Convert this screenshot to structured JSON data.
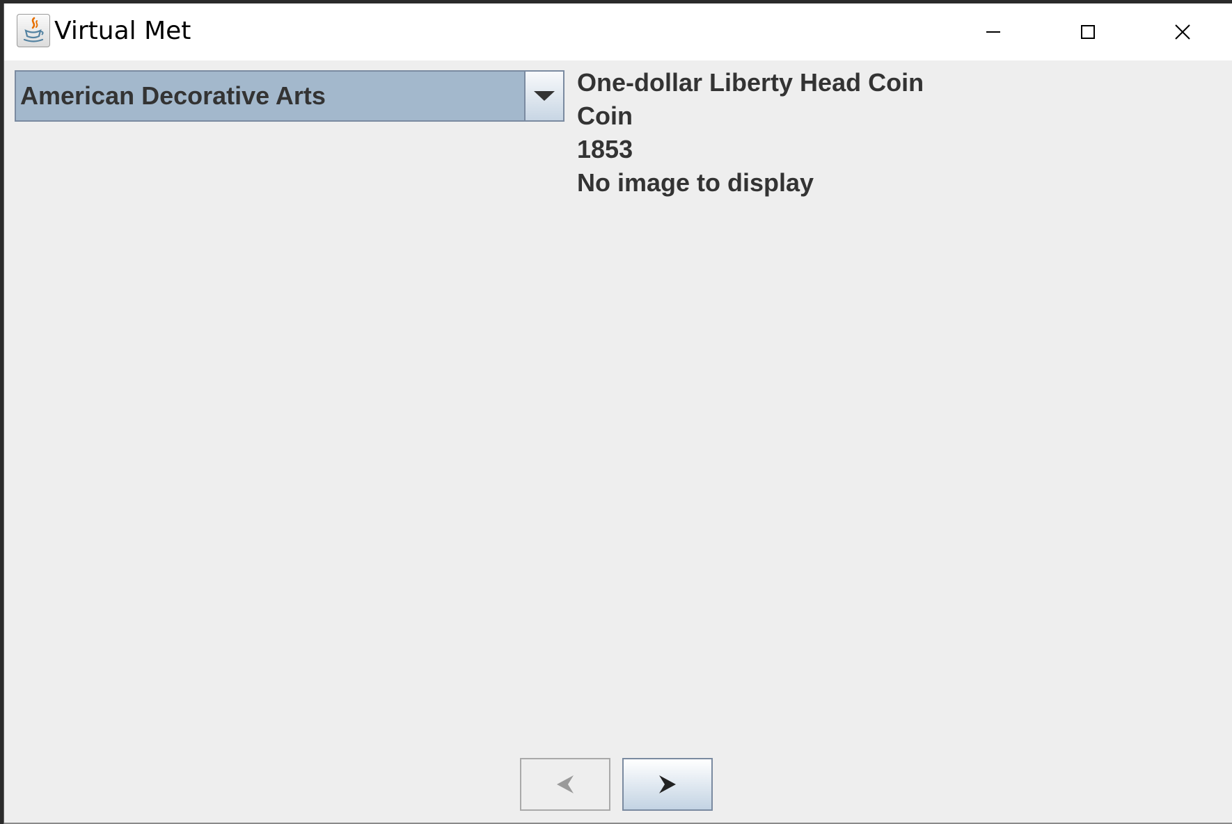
{
  "window": {
    "title": "Virtual Met",
    "controls": {
      "minimize_icon": "minimize-icon",
      "maximize_icon": "maximize-icon",
      "close_icon": "close-icon"
    }
  },
  "department_select": {
    "selected": "American Decorative Arts",
    "arrow_icon": "chevron-down-icon"
  },
  "artwork": {
    "title": "One-dollar Liberty Head Coin",
    "object_type": "Coin",
    "date": "1853",
    "image_status": "No image to display"
  },
  "navigation": {
    "previous_icon": "arrow-left-icon",
    "previous_enabled": false,
    "next_icon": "arrow-right-icon",
    "next_enabled": true
  },
  "colors": {
    "selection_background": "#a3b8cc",
    "window_background": "#eeeeee",
    "text": "#333333"
  }
}
